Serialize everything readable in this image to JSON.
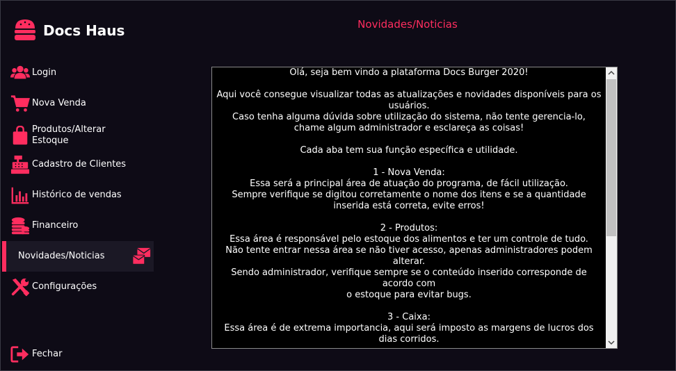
{
  "app": {
    "name": "Docs Haus"
  },
  "colors": {
    "accent": "#ff2d5f",
    "background": "#0e0b16"
  },
  "sidebar": {
    "items": [
      {
        "label": "Login",
        "icon": "users-icon"
      },
      {
        "label": "Nova Venda",
        "icon": "cart-icon"
      },
      {
        "label": "Produtos/Alterar\nEstoque",
        "icon": "shopping-bag-icon"
      },
      {
        "label": "Cadastro de Clientes",
        "icon": "cash-register-icon"
      },
      {
        "label": "Histórico de vendas",
        "icon": "bar-chart-icon"
      },
      {
        "label": "Financeiro",
        "icon": "coins-icon"
      },
      {
        "label": "Novidades/Noticias",
        "icon": "mail-bulk-icon",
        "active": true
      },
      {
        "label": "Configurações",
        "icon": "tools-icon"
      }
    ],
    "close_label": "Fechar"
  },
  "main": {
    "title": "Novidades/Noticias",
    "content": "Olá, seja bem vindo a plataforma Docs Burger 2020!\n\nAqui você consegue visualizar todas as atualizações e novidades disponíveis para os usuários.\nCaso tenha alguma dúvida sobre utilização do sistema, não tente gerencia-lo,\nchame algum administrador e esclareça as coisas!\n\nCada aba tem sua função específica e utilidade.\n\n1 - Nova Venda:\nEssa será a principal área de atuação do programa, de fácil utilização.\nSempre verifique se digitou corretamente o nome dos itens e se a quantidade\ninserida está correta, evite erros!\n\n2 - Produtos:\nEssa área é responsável pelo estoque dos alimentos e ter um controle de tudo.\nNão tente entrar nessa área se não tiver acesso, apenas administradores podem\nalterar.\nSendo administrador, verifique sempre se o conteúdo inserido corresponde de\nacordo com\no estoque para evitar bugs.\n\n3 - Caixa:\nEssa área é de extrema importancia, aqui será imposto as margens de lucros dos\ndias corridos."
  }
}
